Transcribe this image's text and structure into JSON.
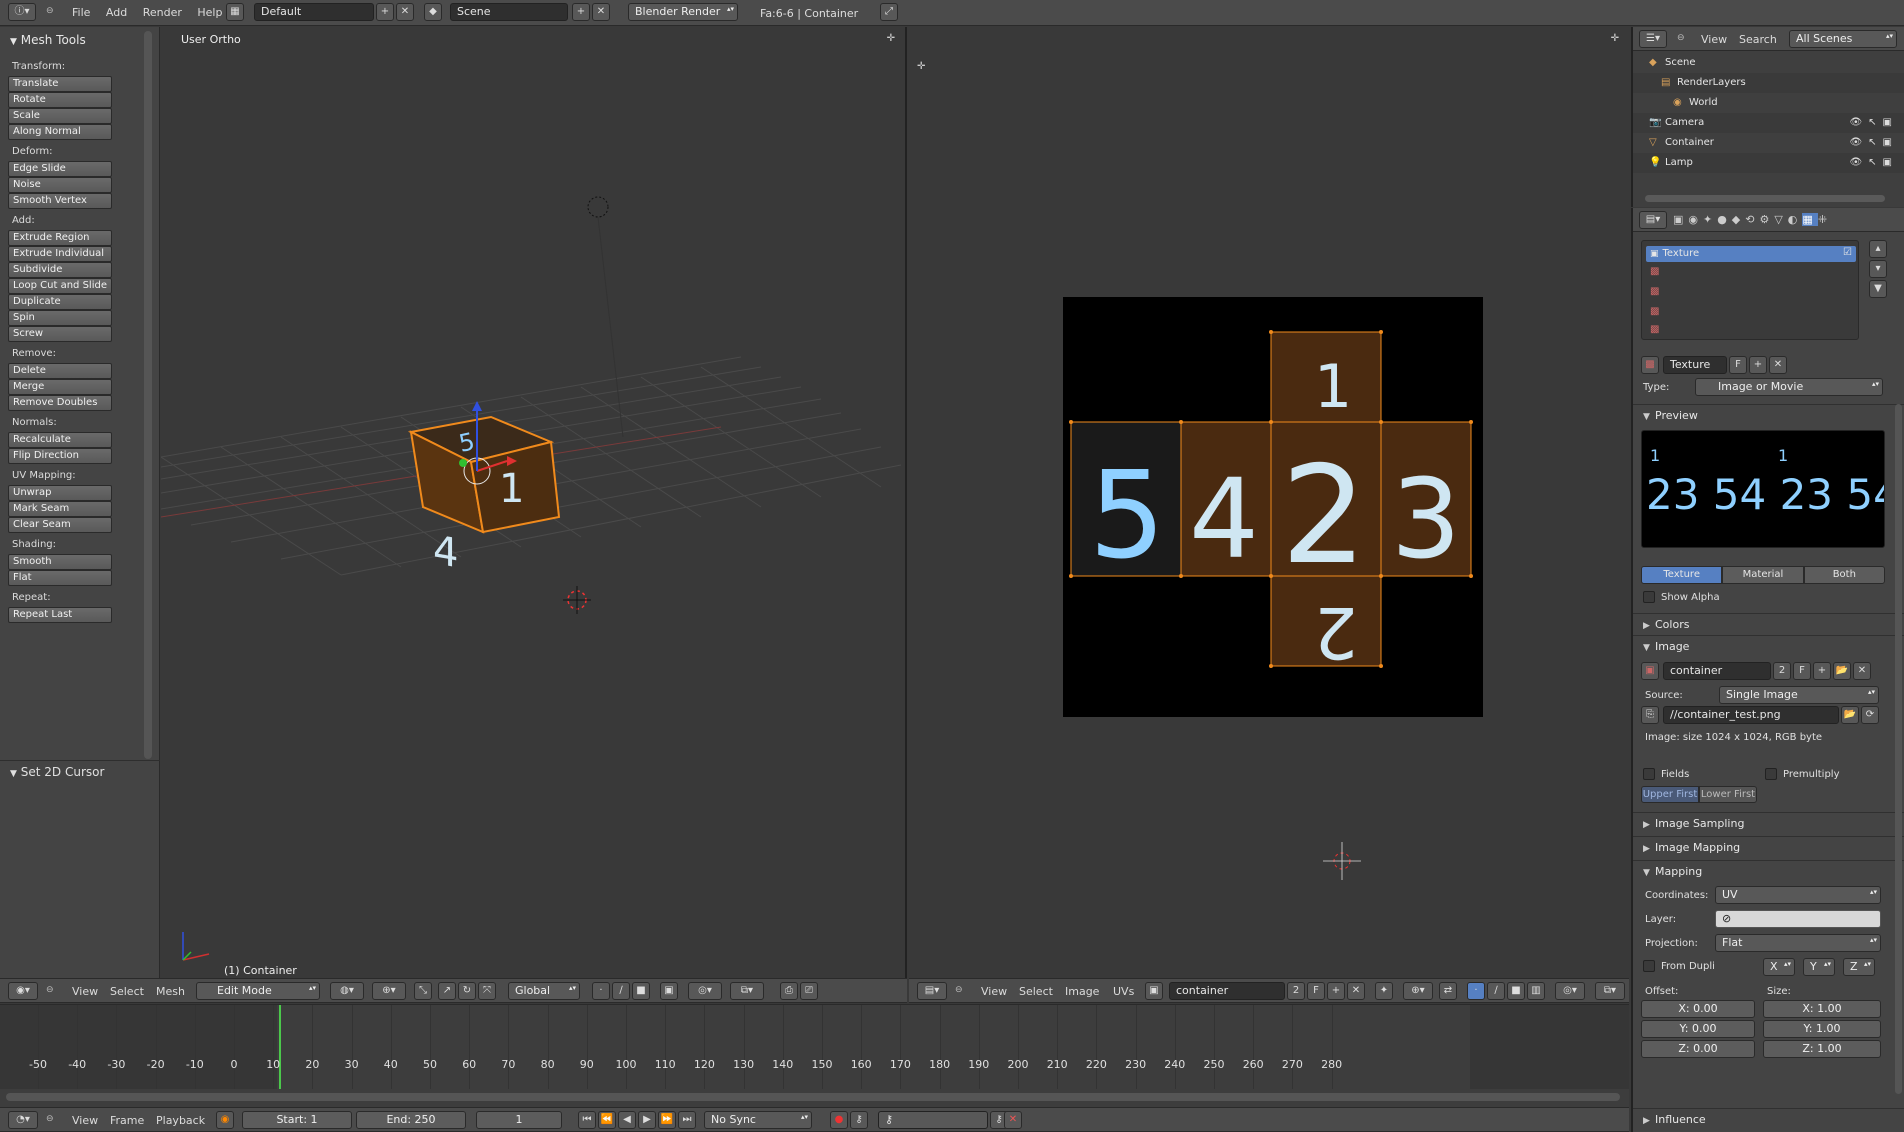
{
  "top_bar": {
    "menus": [
      "File",
      "Add",
      "Render",
      "Help"
    ],
    "layout": "Default",
    "scene": "Scene",
    "engine": "Blender Render",
    "info": "Fa:6-6 | Container"
  },
  "toolshelf": {
    "title": "Mesh Tools",
    "groups": [
      {
        "name": "Transform:",
        "buttons": [
          "Translate",
          "Rotate",
          "Scale",
          "Along Normal"
        ]
      },
      {
        "name": "Deform:",
        "buttons": [
          "Edge Slide",
          "Noise",
          "Smooth Vertex"
        ]
      },
      {
        "name": "Add:",
        "buttons": [
          "Extrude Region",
          "Extrude Individual",
          "Subdivide",
          "Loop Cut and Slide",
          "Duplicate",
          "Spin",
          "Screw"
        ]
      },
      {
        "name": "Remove:",
        "buttons": [
          "Delete",
          "Merge",
          "Remove Doubles"
        ]
      },
      {
        "name": "Normals:",
        "buttons": [
          "Recalculate",
          "Flip Direction"
        ]
      },
      {
        "name": "UV Mapping:",
        "buttons": [
          "Unwrap",
          "Mark Seam",
          "Clear Seam"
        ]
      },
      {
        "name": "Shading:",
        "buttons": [
          "Smooth",
          "Flat"
        ]
      },
      {
        "name": "Repeat:",
        "buttons": [
          "Repeat Last"
        ]
      }
    ],
    "operator_panel": "Set 2D Cursor"
  },
  "viewport3d": {
    "label": "User Ortho",
    "object_label": "(1) Container",
    "header": {
      "menus": [
        "View",
        "Select",
        "Mesh"
      ],
      "mode": "Edit Mode",
      "orientation": "Global"
    }
  },
  "uv_editor": {
    "header": {
      "menus": [
        "View",
        "Select",
        "Image",
        "UVs"
      ],
      "image": "container",
      "users": "2",
      "fake": "F"
    },
    "digits": [
      "1",
      "5",
      "4",
      "2",
      "3",
      "2"
    ]
  },
  "outliner": {
    "menus": [
      "View",
      "Search"
    ],
    "filter": "All Scenes",
    "items": [
      {
        "label": "Scene",
        "icon": "scene-icon"
      },
      {
        "label": "RenderLayers",
        "icon": "renderlayers-icon"
      },
      {
        "label": "World",
        "icon": "world-icon"
      },
      {
        "label": "Camera",
        "icon": "camera-icon"
      },
      {
        "label": "Container",
        "icon": "mesh-icon"
      },
      {
        "label": "Lamp",
        "icon": "lamp-icon"
      }
    ]
  },
  "properties": {
    "texture_slot": "Texture",
    "texture_name": "Texture",
    "texture_fake": "F",
    "type_label": "Type:",
    "type_value": "Image or Movie",
    "preview_title": "Preview",
    "preview_tabs": [
      "Texture",
      "Material",
      "Both"
    ],
    "show_alpha": "Show Alpha",
    "colors": "Colors",
    "image_panel": "Image",
    "image_name": "container",
    "image_users": "2",
    "image_fake": "F",
    "source_label": "Source:",
    "source_value": "Single Image",
    "filepath": "//container_test.png",
    "image_info": "Image: size 1024 x 1024, RGB byte",
    "fields": "Fields",
    "premultiply": "Premultiply",
    "upper_first": "Upper First",
    "lower_first": "Lower First",
    "image_sampling": "Image Sampling",
    "image_mapping": "Image Mapping",
    "mapping": "Mapping",
    "coordinates_label": "Coordinates:",
    "coordinates_value": "UV",
    "layer_label": "Layer:",
    "projection_label": "Projection:",
    "projection_value": "Flat",
    "from_dupli": "From Dupli",
    "axes": [
      "X",
      "Y",
      "Z"
    ],
    "offset_label": "Offset:",
    "size_label": "Size:",
    "offset": [
      "X: 0.00",
      "Y: 0.00",
      "Z: 0.00"
    ],
    "size": [
      "X: 1.00",
      "Y: 1.00",
      "Z: 1.00"
    ],
    "influence": "Influence"
  },
  "timeline": {
    "ticks": [
      "-50",
      "-40",
      "-30",
      "-20",
      "-10",
      "0",
      "10",
      "20",
      "30",
      "40",
      "50",
      "60",
      "70",
      "80",
      "90",
      "100",
      "110",
      "120",
      "130",
      "140",
      "150",
      "160",
      "170",
      "180",
      "190",
      "200",
      "210",
      "220",
      "230",
      "240",
      "250",
      "260",
      "270",
      "280"
    ],
    "menus": [
      "View",
      "Frame",
      "Playback"
    ],
    "start": "Start: 1",
    "end": "End: 250",
    "current": "1",
    "sync": "No Sync"
  },
  "colors": {
    "accent": "#5680c2",
    "selection_orange": "#f08a1c",
    "uv_face": "#4a2a10"
  }
}
